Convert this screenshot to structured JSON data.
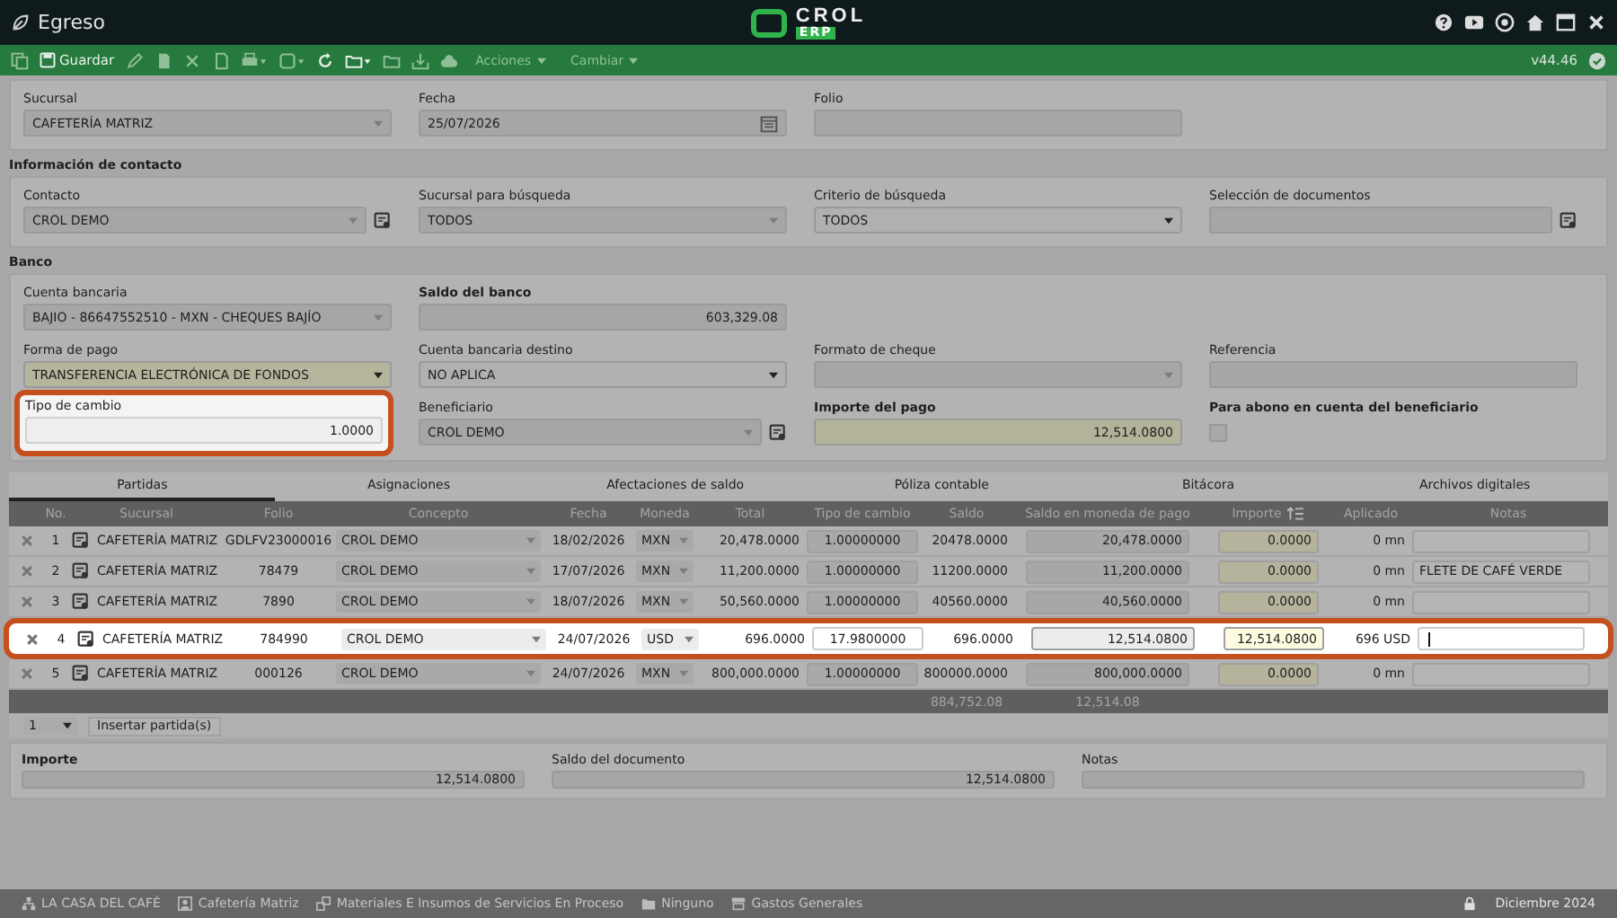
{
  "window": {
    "title": "Egreso",
    "logo": "CROL",
    "logo_sub": "ERP"
  },
  "toolbar": {
    "save_label": "Guardar",
    "menus": [
      "Acciones",
      "Cambiar"
    ],
    "version": "v44.46"
  },
  "general": {
    "rows": [
      [
        {
          "label": "Sucursal",
          "kind": "select",
          "value": "CAFETERÍA MATRIZ"
        },
        {
          "label": "Fecha",
          "kind": "date",
          "value": "25/07/2026"
        },
        {
          "label": "Folio",
          "kind": "text"
        }
      ]
    ]
  },
  "contact": {
    "title": "Información de contacto",
    "rows": [
      [
        {
          "label": "Contacto",
          "kind": "select",
          "value": "CROL DEMO",
          "lookup": true
        },
        {
          "label": "Sucursal para búsqueda",
          "kind": "select",
          "value": "TODOS"
        },
        {
          "label": "Criterio de búsqueda",
          "kind": "dropdown",
          "value": "TODOS"
        },
        {
          "label": "Selección de documentos",
          "kind": "text",
          "lookup": true
        }
      ]
    ]
  },
  "bank": {
    "title": "Banco",
    "rows": [
      [
        {
          "label": "Cuenta bancaria",
          "kind": "select",
          "value": "BAJIO - 86647552510 - MXN - CHEQUES BAJÍO"
        },
        {
          "label": "Saldo del banco",
          "kind": "number",
          "value": "603,329.08",
          "bold": true
        }
      ],
      [
        {
          "label": "Forma de pago",
          "kind": "dropdown",
          "value": "TRANSFERENCIA ELECTRÓNICA DE FONDOS",
          "required": true
        },
        {
          "label": "Cuenta bancaria destino",
          "kind": "dropdown",
          "value": "NO APLICA"
        },
        {
          "label": "Formato de cheque",
          "kind": "select"
        },
        {
          "label": "Referencia",
          "kind": "text"
        }
      ],
      [
        {
          "label": "Tipo de cambio",
          "kind": "number",
          "value": "1.0000",
          "highlighted": true
        },
        {
          "label": "Beneficiario",
          "kind": "select",
          "value": "CROL DEMO",
          "lookup": true
        },
        {
          "label": "Importe del pago",
          "kind": "number",
          "value": "12,514.0800",
          "bold": true,
          "required": true
        },
        {
          "label": "Para abono en cuenta del beneficiario",
          "kind": "checkbox",
          "bold": true,
          "checked": false
        }
      ]
    ]
  },
  "tabs": [
    {
      "label": "Partidas",
      "selected": true
    },
    {
      "label": "Asignaciones",
      "selected": false
    },
    {
      "label": "Afectaciones de saldo",
      "selected": false
    },
    {
      "label": "Póliza contable",
      "selected": false
    },
    {
      "label": "Bitácora",
      "selected": false
    },
    {
      "label": "Archivos digitales",
      "selected": false
    }
  ],
  "table": {
    "columns": [
      "No.",
      "Sucursal",
      "Folio",
      "Concepto",
      "Fecha",
      "Moneda",
      "Total",
      "Tipo de cambio",
      "Saldo",
      "Saldo en moneda de pago",
      "Importe",
      "Aplicado",
      "Notas"
    ],
    "rows": [
      {
        "no": "1",
        "sucursal": "CAFETERÍA MATRIZ",
        "folio": "GDLFV23000016",
        "concepto": "CROL DEMO",
        "fecha": "18/02/2026",
        "moneda": "MXN",
        "total": "20,478.0000",
        "tipo_cambio": "1.00000000",
        "saldo": "20478.0000",
        "saldo_moneda_pago": "20,478.0000",
        "importe": "0.0000",
        "aplicado": "0 mn",
        "highlighted": false
      },
      {
        "no": "2",
        "sucursal": "CAFETERÍA MATRIZ",
        "folio": "78479",
        "concepto": "CROL DEMO",
        "fecha": "17/07/2026",
        "moneda": "MXN",
        "total": "11,200.0000",
        "tipo_cambio": "1.00000000",
        "saldo": "11200.0000",
        "saldo_moneda_pago": "11,200.0000",
        "importe": "0.0000",
        "aplicado": "0 mn",
        "notas": "FLETE DE CAFÉ VERDE",
        "highlighted": false
      },
      {
        "no": "3",
        "sucursal": "CAFETERÍA MATRIZ",
        "folio": "7890",
        "concepto": "CROL DEMO",
        "fecha": "18/07/2026",
        "moneda": "MXN",
        "total": "50,560.0000",
        "tipo_cambio": "1.00000000",
        "saldo": "40560.0000",
        "saldo_moneda_pago": "40,560.0000",
        "importe": "0.0000",
        "aplicado": "0 mn",
        "highlighted": false
      },
      {
        "no": "4",
        "sucursal": "CAFETERÍA MATRIZ",
        "folio": "784990",
        "concepto": "CROL DEMO",
        "fecha": "24/07/2026",
        "moneda": "USD",
        "total": "696.0000",
        "tipo_cambio": "17.9800000",
        "saldo": "696.0000",
        "saldo_moneda_pago": "12,514.0800",
        "importe": "12,514.0800",
        "aplicado": "696 USD",
        "highlighted": true
      },
      {
        "no": "5",
        "sucursal": "CAFETERÍA MATRIZ",
        "folio": "000126",
        "concepto": "CROL DEMO",
        "fecha": "24/07/2026",
        "moneda": "MXN",
        "total": "800,000.0000",
        "tipo_cambio": "1.00000000",
        "saldo": "800000.0000",
        "saldo_moneda_pago": "800,000.0000",
        "importe": "0.0000",
        "aplicado": "0 mn",
        "highlighted": false
      }
    ],
    "totals": {
      "saldo": "884,752.08",
      "saldo_moneda_pago": "12,514.08"
    }
  },
  "insert": {
    "count": "1",
    "label": "Insertar partida(s)"
  },
  "summary": [
    {
      "label": "Importe",
      "value": "12,514.0800",
      "bold": true
    },
    {
      "label": "Saldo del documento",
      "value": "12,514.0800",
      "bold": false
    },
    {
      "label": "Notas",
      "bold": false
    }
  ],
  "status_bar": {
    "items": [
      {
        "kind": "company",
        "label": "LA CASA DEL CAFÉ"
      },
      {
        "kind": "branch",
        "label": "Cafetería Matriz"
      },
      {
        "kind": "warehouse",
        "label": "Materiales E Insumos de Servicios En Proceso"
      },
      {
        "kind": "folder",
        "label": "Ninguno"
      },
      {
        "kind": "register",
        "label": "Gastos Generales"
      }
    ],
    "period": "Diciembre 2024"
  }
}
